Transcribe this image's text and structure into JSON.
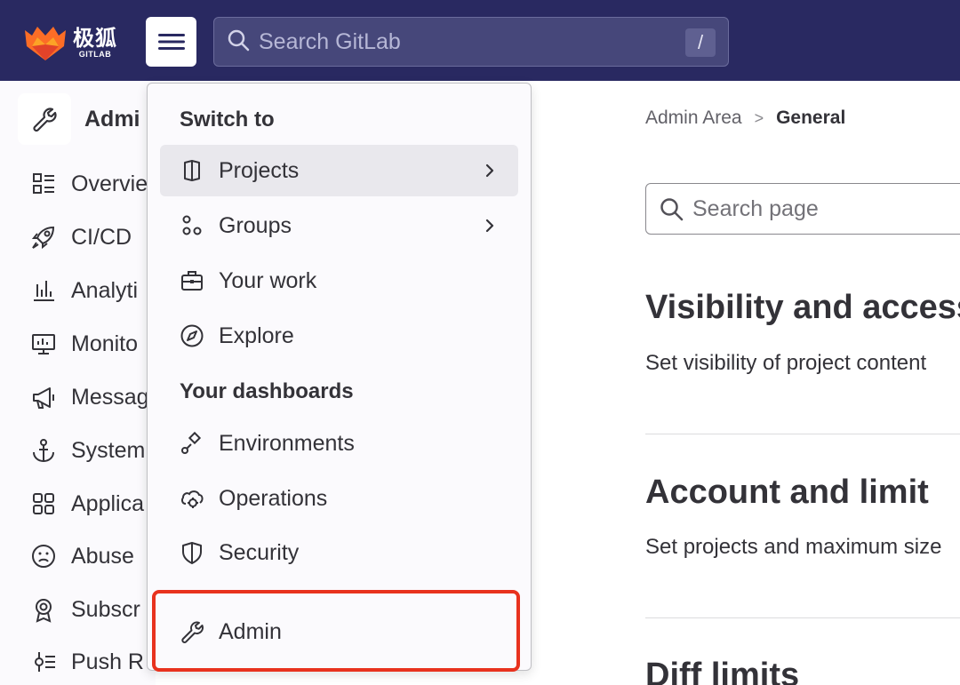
{
  "header": {
    "logo_cn": "极狐",
    "logo_en": "GITLAB",
    "search_placeholder": "Search GitLab",
    "search_shortcut": "/",
    "brand_color": "#292961"
  },
  "sidebar": {
    "title": "Admi",
    "items": [
      {
        "label": "Overvie",
        "icon": "overview-icon"
      },
      {
        "label": "CI/CD",
        "icon": "rocket-icon"
      },
      {
        "label": "Analyti",
        "icon": "chart-icon"
      },
      {
        "label": "Monito",
        "icon": "monitor-icon"
      },
      {
        "label": "Messag",
        "icon": "megaphone-icon"
      },
      {
        "label": "System",
        "icon": "anchor-icon"
      },
      {
        "label": "Applica",
        "icon": "apps-icon"
      },
      {
        "label": "Abuse",
        "icon": "sad-face-icon"
      },
      {
        "label": "Subscr",
        "icon": "badge-icon"
      },
      {
        "label": "Push R",
        "icon": "push-rules-icon"
      }
    ]
  },
  "dropdown": {
    "switch_heading": "Switch to",
    "switch_items": [
      {
        "label": "Projects",
        "icon": "project-icon",
        "has_submenu": true
      },
      {
        "label": "Groups",
        "icon": "group-icon",
        "has_submenu": true
      },
      {
        "label": "Your work",
        "icon": "briefcase-icon",
        "has_submenu": false
      },
      {
        "label": "Explore",
        "icon": "compass-icon",
        "has_submenu": false
      }
    ],
    "dashboards_heading": "Your dashboards",
    "dashboard_items": [
      {
        "label": "Environments",
        "icon": "environment-icon"
      },
      {
        "label": "Operations",
        "icon": "operations-icon"
      },
      {
        "label": "Security",
        "icon": "shield-icon"
      }
    ],
    "admin_item": {
      "label": "Admin",
      "icon": "wrench-icon"
    },
    "highlight_color": "#e8321e"
  },
  "main": {
    "breadcrumb": [
      "Admin Area",
      "General"
    ],
    "search_placeholder": "Search page",
    "sections": [
      {
        "title": "Visibility and access",
        "description": "Set visibility of project content"
      },
      {
        "title": "Account and limit",
        "description": "Set projects and maximum size"
      },
      {
        "title": "Diff limits",
        "description": ""
      }
    ]
  }
}
